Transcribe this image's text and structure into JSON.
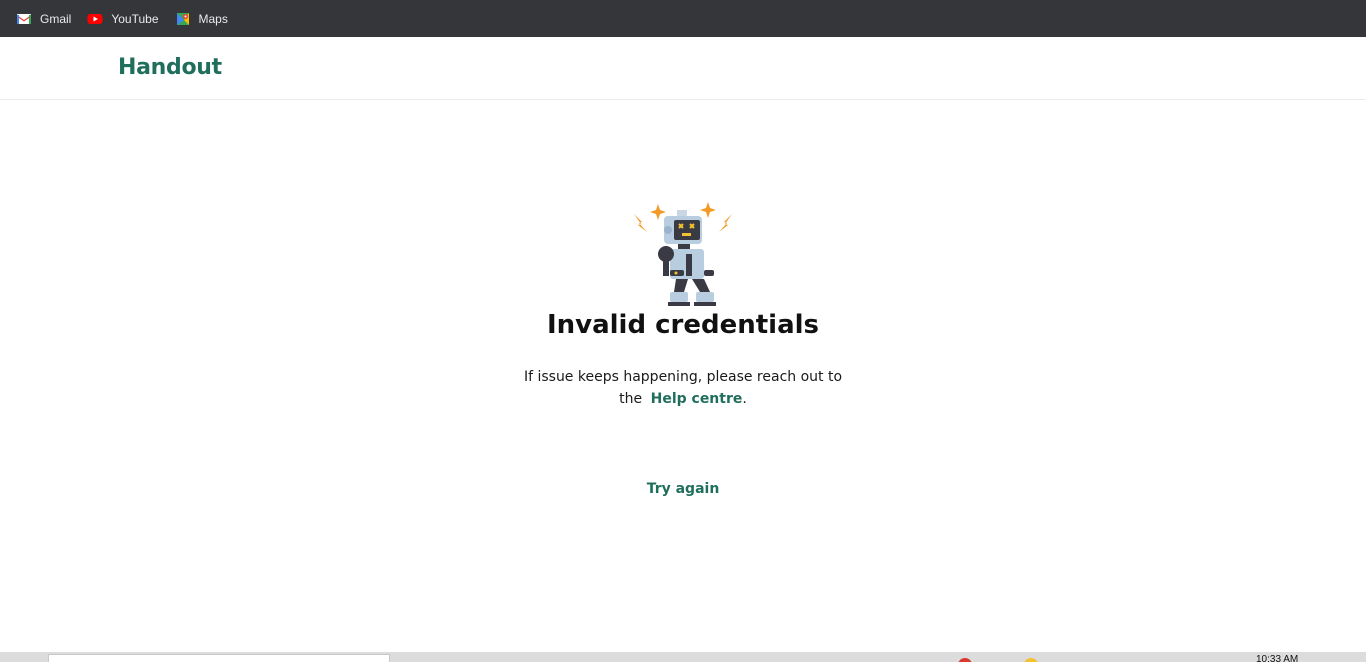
{
  "bookmarks": [
    {
      "label": "Gmail",
      "icon": "gmail-icon"
    },
    {
      "label": "YouTube",
      "icon": "youtube-icon"
    },
    {
      "label": "Maps",
      "icon": "maps-icon"
    }
  ],
  "header": {
    "logo_text": "Handout"
  },
  "main": {
    "illustration": "broken-robot-icon",
    "title": "Invalid credentials",
    "message_prefix": "If issue keeps happening, please reach out to the",
    "help_link": "Help centre",
    "message_suffix": ".",
    "try_again": "Try again"
  },
  "taskbar": {
    "clock": "10:33 AM"
  },
  "colors": {
    "brand": "#1f6f5c",
    "bookmarks_bar": "#35363a",
    "accent_orange": "#f39a26"
  }
}
